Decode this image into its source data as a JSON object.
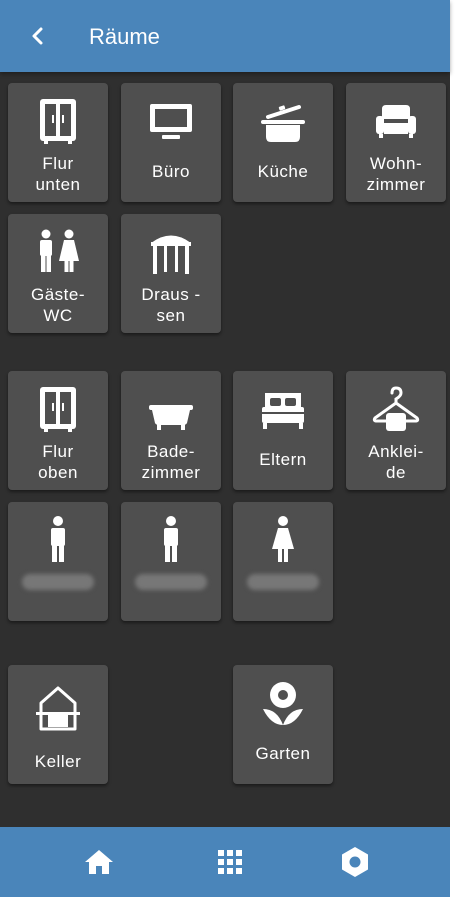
{
  "header": {
    "title": "Räume"
  },
  "tiles": [
    {
      "label": "Flur\nunten",
      "icon": "wardrobe-icon"
    },
    {
      "label": "Büro",
      "icon": "tv-icon"
    },
    {
      "label": "Küche",
      "icon": "cooking-pot-icon"
    },
    {
      "label": "Wohn-\nzimmer",
      "icon": "sofa-icon"
    },
    {
      "label": "Gäste-\nWC",
      "icon": "people-icon"
    },
    {
      "label": "Draus -\nsen",
      "icon": "gazebo-icon"
    },
    {
      "label": "Flur\noben",
      "icon": "wardrobe-icon"
    },
    {
      "label": "Bade-\nzimmer",
      "icon": "bathtub-icon"
    },
    {
      "label": "Eltern",
      "icon": "bed-icon"
    },
    {
      "label": "Anklei-\nde",
      "icon": "hanger-icon"
    },
    {
      "label": "",
      "icon": "person-male-icon"
    },
    {
      "label": "",
      "icon": "person-male-icon"
    },
    {
      "label": "",
      "icon": "person-female-icon"
    },
    {
      "label": "Keller",
      "icon": "cellar-icon"
    },
    {
      "label": "Garten",
      "icon": "flower-icon"
    }
  ],
  "bottom_nav": [
    {
      "icon": "home-icon"
    },
    {
      "icon": "grid-icon"
    },
    {
      "icon": "settings-icon"
    }
  ],
  "colors": {
    "bar": "#4a85ba",
    "background": "#2f2f2f",
    "tile": "#4f4f4f"
  }
}
